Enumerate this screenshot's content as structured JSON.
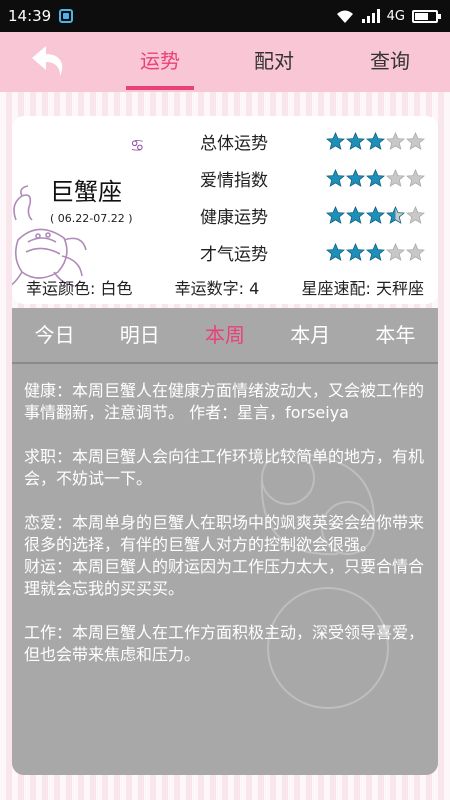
{
  "status_bar": {
    "time": "14:39",
    "network": "4G"
  },
  "header": {
    "tabs": [
      {
        "label": "运势",
        "active": true
      },
      {
        "label": "配对",
        "active": false
      },
      {
        "label": "查询",
        "active": false
      }
    ]
  },
  "sign": {
    "symbol": "♋",
    "name": "巨蟹座",
    "dates": "( 06.22-07.22 )"
  },
  "ratings": [
    {
      "label": "总体运势",
      "stars": 3
    },
    {
      "label": "爱情指数",
      "stars": 3
    },
    {
      "label": "健康运势",
      "stars": 3.5
    },
    {
      "label": "才气运势",
      "stars": 3
    }
  ],
  "lucky": {
    "color": "幸运颜色: 白色",
    "number": "幸运数字: 4",
    "match": "星座速配: 天秤座"
  },
  "period_tabs": [
    {
      "label": "今日",
      "active": false
    },
    {
      "label": "明日",
      "active": false
    },
    {
      "label": "本周",
      "active": true
    },
    {
      "label": "本月",
      "active": false
    },
    {
      "label": "本年",
      "active": false
    }
  ],
  "forecast": {
    "health": "健康：本周巨蟹人在健康方面情绪波动大，又会被工作的事情翻新，注意调节。 作者：星言，forseiya",
    "job": "求职：本周巨蟹人会向往工作环境比较简单的地方，有机会，不妨试一下。",
    "love": "恋爱：本周单身的巨蟹人在职场中的飒爽英姿会给你带来很多的选择，有伴的巨蟹人对方的控制欲会很强。",
    "wealth": "财运：本周巨蟹人的财运因为工作压力太大，只要合情合理就会忘我的买买买。",
    "work": "工作：本周巨蟹人在工作方面积极主动，深受领导喜爱，但也会带来焦虑和压力。"
  },
  "colors": {
    "accent": "#e9417a",
    "star_filled": "#1e8fb8",
    "star_empty": "#c8c8c8",
    "header_bg": "#f9c6d6",
    "panel_bg": "#a8a8a8"
  }
}
